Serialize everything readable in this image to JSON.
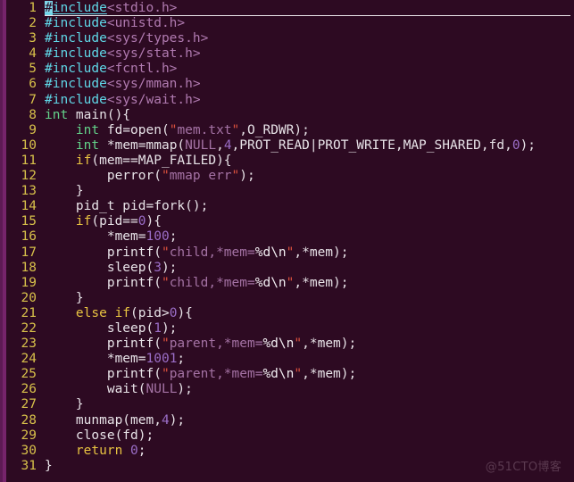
{
  "editor": {
    "title": "vim-c-source-view",
    "filetype": "c",
    "total_lines": 31,
    "colors": {
      "background": "#2d0a22",
      "edge_bar": "#76246b",
      "line_number": "#d7c04a",
      "foreground": "#e8e3e8",
      "preprocessor": "#5fd7e7",
      "header_path": "#b07ab0",
      "type": "#63d38a",
      "keyword": "#e8c341",
      "number": "#9b6ec8",
      "string": "#a472a4",
      "quote": "#d94f3d",
      "cursor": "#7fd6e8"
    },
    "cursor": {
      "line": 1,
      "column": 1,
      "char": "#"
    }
  },
  "watermark": {
    "text": "@51CTO博客"
  },
  "lines": [
    {
      "n": "1",
      "tokens": [
        {
          "t": "#",
          "c": "t-pre cursor-block under"
        },
        {
          "t": "include",
          "c": "t-pre under"
        },
        {
          "t": "<stdio.h>",
          "c": "t-hdr"
        }
      ]
    },
    {
      "n": "2",
      "tokens": [
        {
          "t": "#include",
          "c": "t-pre"
        },
        {
          "t": "<unistd.h>",
          "c": "t-hdr"
        }
      ]
    },
    {
      "n": "3",
      "tokens": [
        {
          "t": "#include",
          "c": "t-pre"
        },
        {
          "t": "<sys/types.h>",
          "c": "t-hdr"
        }
      ]
    },
    {
      "n": "4",
      "tokens": [
        {
          "t": "#include",
          "c": "t-pre"
        },
        {
          "t": "<sys/stat.h>",
          "c": "t-hdr"
        }
      ]
    },
    {
      "n": "5",
      "tokens": [
        {
          "t": "#include",
          "c": "t-pre"
        },
        {
          "t": "<fcntl.h>",
          "c": "t-hdr"
        }
      ]
    },
    {
      "n": "6",
      "tokens": [
        {
          "t": "#include",
          "c": "t-pre"
        },
        {
          "t": "<sys/mman.h>",
          "c": "t-hdr"
        }
      ]
    },
    {
      "n": "7",
      "tokens": [
        {
          "t": "#include",
          "c": "t-pre"
        },
        {
          "t": "<sys/wait.h>",
          "c": "t-hdr"
        }
      ]
    },
    {
      "n": "8",
      "tokens": [
        {
          "t": "int",
          "c": "t-type"
        },
        {
          "t": " main(){",
          "c": "t-plain"
        }
      ]
    },
    {
      "n": "9",
      "tokens": [
        {
          "t": "    ",
          "c": "t-plain"
        },
        {
          "t": "int",
          "c": "t-type"
        },
        {
          "t": " fd=open(",
          "c": "t-plain"
        },
        {
          "t": "\"",
          "c": "t-quote"
        },
        {
          "t": "mem.txt",
          "c": "t-str"
        },
        {
          "t": "\"",
          "c": "t-quote"
        },
        {
          "t": ",O_RDWR);",
          "c": "t-plain"
        }
      ]
    },
    {
      "n": "10",
      "tokens": [
        {
          "t": "    ",
          "c": "t-plain"
        },
        {
          "t": "int",
          "c": "t-type"
        },
        {
          "t": " *mem=mmap(",
          "c": "t-plain"
        },
        {
          "t": "NULL",
          "c": "t-str"
        },
        {
          "t": ",",
          "c": "t-plain"
        },
        {
          "t": "4",
          "c": "t-num"
        },
        {
          "t": ",PROT_READ|PROT_WRITE,MAP_SHARED,fd,",
          "c": "t-plain"
        },
        {
          "t": "0",
          "c": "t-num"
        },
        {
          "t": ");",
          "c": "t-plain"
        }
      ]
    },
    {
      "n": "11",
      "tokens": [
        {
          "t": "    ",
          "c": "t-plain"
        },
        {
          "t": "if",
          "c": "t-kw"
        },
        {
          "t": "(mem==MAP_FAILED){",
          "c": "t-plain"
        }
      ]
    },
    {
      "n": "12",
      "tokens": [
        {
          "t": "        perror(",
          "c": "t-plain"
        },
        {
          "t": "\"",
          "c": "t-quote"
        },
        {
          "t": "mmap err",
          "c": "t-str"
        },
        {
          "t": "\"",
          "c": "t-quote"
        },
        {
          "t": ");",
          "c": "t-plain"
        }
      ]
    },
    {
      "n": "13",
      "tokens": [
        {
          "t": "    }",
          "c": "t-plain"
        }
      ]
    },
    {
      "n": "14",
      "tokens": [
        {
          "t": "    pid_t pid=fork();",
          "c": "t-plain"
        }
      ]
    },
    {
      "n": "15",
      "tokens": [
        {
          "t": "    ",
          "c": "t-plain"
        },
        {
          "t": "if",
          "c": "t-kw"
        },
        {
          "t": "(pid==",
          "c": "t-plain"
        },
        {
          "t": "0",
          "c": "t-num"
        },
        {
          "t": "){",
          "c": "t-plain"
        }
      ]
    },
    {
      "n": "16",
      "tokens": [
        {
          "t": "        *mem=",
          "c": "t-plain"
        },
        {
          "t": "100",
          "c": "t-num"
        },
        {
          "t": ";",
          "c": "t-plain"
        }
      ]
    },
    {
      "n": "17",
      "tokens": [
        {
          "t": "        printf(",
          "c": "t-plain"
        },
        {
          "t": "\"",
          "c": "t-quote"
        },
        {
          "t": "child,*mem=",
          "c": "t-str"
        },
        {
          "t": "%d",
          "c": "t-esc"
        },
        {
          "t": "\\n",
          "c": "t-esc"
        },
        {
          "t": "\"",
          "c": "t-quote"
        },
        {
          "t": ",*mem);",
          "c": "t-plain"
        }
      ]
    },
    {
      "n": "18",
      "tokens": [
        {
          "t": "        sleep(",
          "c": "t-plain"
        },
        {
          "t": "3",
          "c": "t-num"
        },
        {
          "t": ");",
          "c": "t-plain"
        }
      ]
    },
    {
      "n": "19",
      "tokens": [
        {
          "t": "        printf(",
          "c": "t-plain"
        },
        {
          "t": "\"",
          "c": "t-quote"
        },
        {
          "t": "child,*mem=",
          "c": "t-str"
        },
        {
          "t": "%d",
          "c": "t-esc"
        },
        {
          "t": "\\n",
          "c": "t-esc"
        },
        {
          "t": "\"",
          "c": "t-quote"
        },
        {
          "t": ",*mem);",
          "c": "t-plain"
        }
      ]
    },
    {
      "n": "20",
      "tokens": [
        {
          "t": "    }",
          "c": "t-plain"
        }
      ]
    },
    {
      "n": "21",
      "tokens": [
        {
          "t": "    ",
          "c": "t-plain"
        },
        {
          "t": "else",
          "c": "t-kw"
        },
        {
          "t": " ",
          "c": "t-plain"
        },
        {
          "t": "if",
          "c": "t-kw"
        },
        {
          "t": "(pid>",
          "c": "t-plain"
        },
        {
          "t": "0",
          "c": "t-num"
        },
        {
          "t": "){",
          "c": "t-plain"
        }
      ]
    },
    {
      "n": "22",
      "tokens": [
        {
          "t": "        sleep(",
          "c": "t-plain"
        },
        {
          "t": "1",
          "c": "t-num"
        },
        {
          "t": ");",
          "c": "t-plain"
        }
      ]
    },
    {
      "n": "23",
      "tokens": [
        {
          "t": "        printf(",
          "c": "t-plain"
        },
        {
          "t": "\"",
          "c": "t-quote"
        },
        {
          "t": "parent,*mem=",
          "c": "t-str"
        },
        {
          "t": "%d",
          "c": "t-esc"
        },
        {
          "t": "\\n",
          "c": "t-esc"
        },
        {
          "t": "\"",
          "c": "t-quote"
        },
        {
          "t": ",*mem);",
          "c": "t-plain"
        }
      ]
    },
    {
      "n": "24",
      "tokens": [
        {
          "t": "        *mem=",
          "c": "t-plain"
        },
        {
          "t": "1001",
          "c": "t-num"
        },
        {
          "t": ";",
          "c": "t-plain"
        }
      ]
    },
    {
      "n": "25",
      "tokens": [
        {
          "t": "        printf(",
          "c": "t-plain"
        },
        {
          "t": "\"",
          "c": "t-quote"
        },
        {
          "t": "parent,*mem=",
          "c": "t-str"
        },
        {
          "t": "%d",
          "c": "t-esc"
        },
        {
          "t": "\\n",
          "c": "t-esc"
        },
        {
          "t": "\"",
          "c": "t-quote"
        },
        {
          "t": ",*mem);",
          "c": "t-plain"
        }
      ]
    },
    {
      "n": "26",
      "tokens": [
        {
          "t": "        wait(",
          "c": "t-plain"
        },
        {
          "t": "NULL",
          "c": "t-str"
        },
        {
          "t": ");",
          "c": "t-plain"
        }
      ]
    },
    {
      "n": "27",
      "tokens": [
        {
          "t": "    }",
          "c": "t-plain"
        }
      ]
    },
    {
      "n": "28",
      "tokens": [
        {
          "t": "    munmap(mem,",
          "c": "t-plain"
        },
        {
          "t": "4",
          "c": "t-num"
        },
        {
          "t": ");",
          "c": "t-plain"
        }
      ]
    },
    {
      "n": "29",
      "tokens": [
        {
          "t": "    close(fd);",
          "c": "t-plain"
        }
      ]
    },
    {
      "n": "30",
      "tokens": [
        {
          "t": "    ",
          "c": "t-plain"
        },
        {
          "t": "return",
          "c": "t-kw"
        },
        {
          "t": " ",
          "c": "t-plain"
        },
        {
          "t": "0",
          "c": "t-num"
        },
        {
          "t": ";",
          "c": "t-plain"
        }
      ]
    },
    {
      "n": "31",
      "tokens": [
        {
          "t": "}",
          "c": "t-plain"
        }
      ]
    }
  ]
}
